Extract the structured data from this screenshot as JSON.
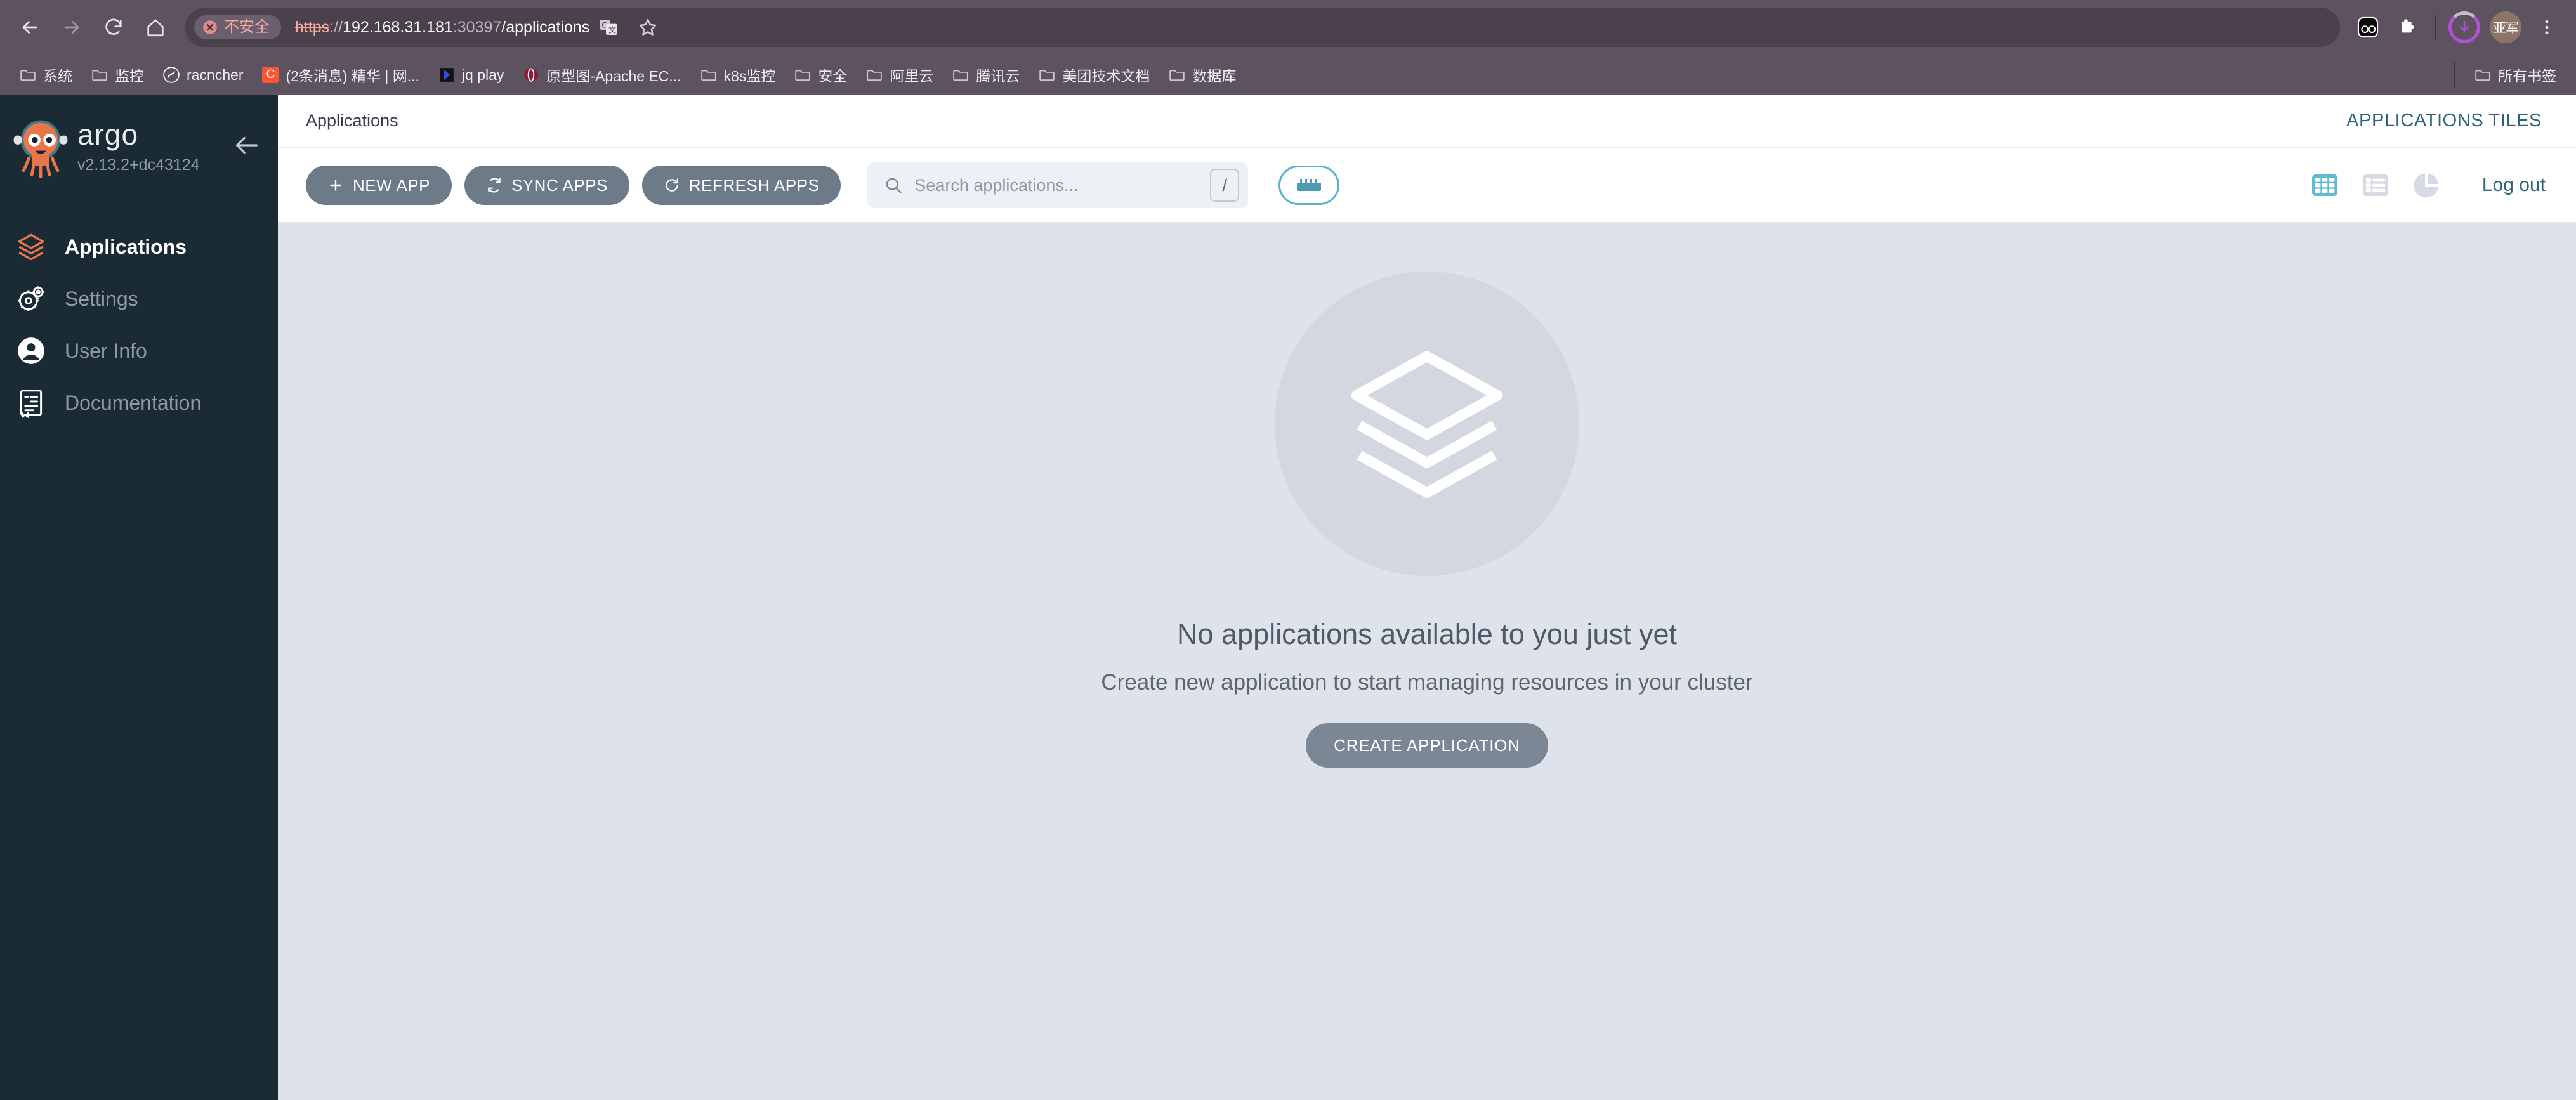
{
  "browser": {
    "back_icon": "back-arrow-icon",
    "forward_icon": "forward-arrow-icon",
    "reload_icon": "reload-icon",
    "home_icon": "home-icon",
    "security_badge": "不安全",
    "url_scheme": "https",
    "url_separator": "://",
    "url_host": "192.168.31.181",
    "url_port": ":30397",
    "url_path": "/applications",
    "translate_icon": "translate-icon",
    "bookmark_star_icon": "star-icon",
    "extension_icon": "extension-app-icon",
    "puzzle_icon": "puzzle-extensions-icon",
    "download_icon": "download-progress-icon",
    "avatar_label": "亚军",
    "menu_icon": "three-dot-menu-icon",
    "bookmarks": [
      {
        "label": "系统",
        "icon": "folder"
      },
      {
        "label": "监控",
        "icon": "folder"
      },
      {
        "label": "racncher",
        "icon": "rancher",
        "color": "#ffffff"
      },
      {
        "label": "(2条消息) 精华 | 网...",
        "icon": "csdn",
        "color": "#fc5531"
      },
      {
        "label": "jq play",
        "icon": "jq",
        "color": "#1a3bd6"
      },
      {
        "label": "原型图-Apache EC...",
        "icon": "echarts",
        "color": "#8b1c36"
      },
      {
        "label": "k8s监控",
        "icon": "folder"
      },
      {
        "label": "安全",
        "icon": "folder"
      },
      {
        "label": "阿里云",
        "icon": "folder"
      },
      {
        "label": "腾讯云",
        "icon": "folder"
      },
      {
        "label": "美团技术文档",
        "icon": "folder"
      },
      {
        "label": "数据库",
        "icon": "folder"
      }
    ],
    "all_bookmarks_label": "所有书签",
    "all_bookmarks_icon": "folder"
  },
  "sidebar": {
    "brand": "argo",
    "version": "v2.13.2+dc43124",
    "logo_icon": "argo-octopus-logo",
    "collapse_icon": "left-arrow-icon",
    "items": [
      {
        "label": "Applications",
        "icon": "layers-icon",
        "active": true
      },
      {
        "label": "Settings",
        "icon": "gears-icon",
        "active": false
      },
      {
        "label": "User Info",
        "icon": "user-circle-icon",
        "active": false
      },
      {
        "label": "Documentation",
        "icon": "book-icon",
        "active": false
      }
    ]
  },
  "header": {
    "title": "Applications",
    "right_link": "APPLICATIONS TILES"
  },
  "toolbar": {
    "new_app_label": "NEW APP",
    "new_app_icon": "plus-icon",
    "sync_apps_label": "SYNC APPS",
    "sync_apps_icon": "sync-icon",
    "refresh_apps_label": "REFRESH APPS",
    "refresh_apps_icon": "refresh-icon",
    "search_placeholder": "Search applications...",
    "search_value": "",
    "search_icon": "search-icon",
    "slash_hint": "/",
    "filter_icon": "filter-sliders-icon",
    "tiles_view_icon": "grid-tiles-icon",
    "list_view_icon": "list-view-icon",
    "summary_view_icon": "pie-chart-icon",
    "logout_label": "Log out",
    "accent_color": "#56b4ca"
  },
  "empty_state": {
    "illustration_icon": "stacked-layers-icon",
    "title": "No applications available to you just yet",
    "subtitle": "Create new application to start managing resources in your cluster",
    "button_label": "CREATE APPLICATION"
  }
}
